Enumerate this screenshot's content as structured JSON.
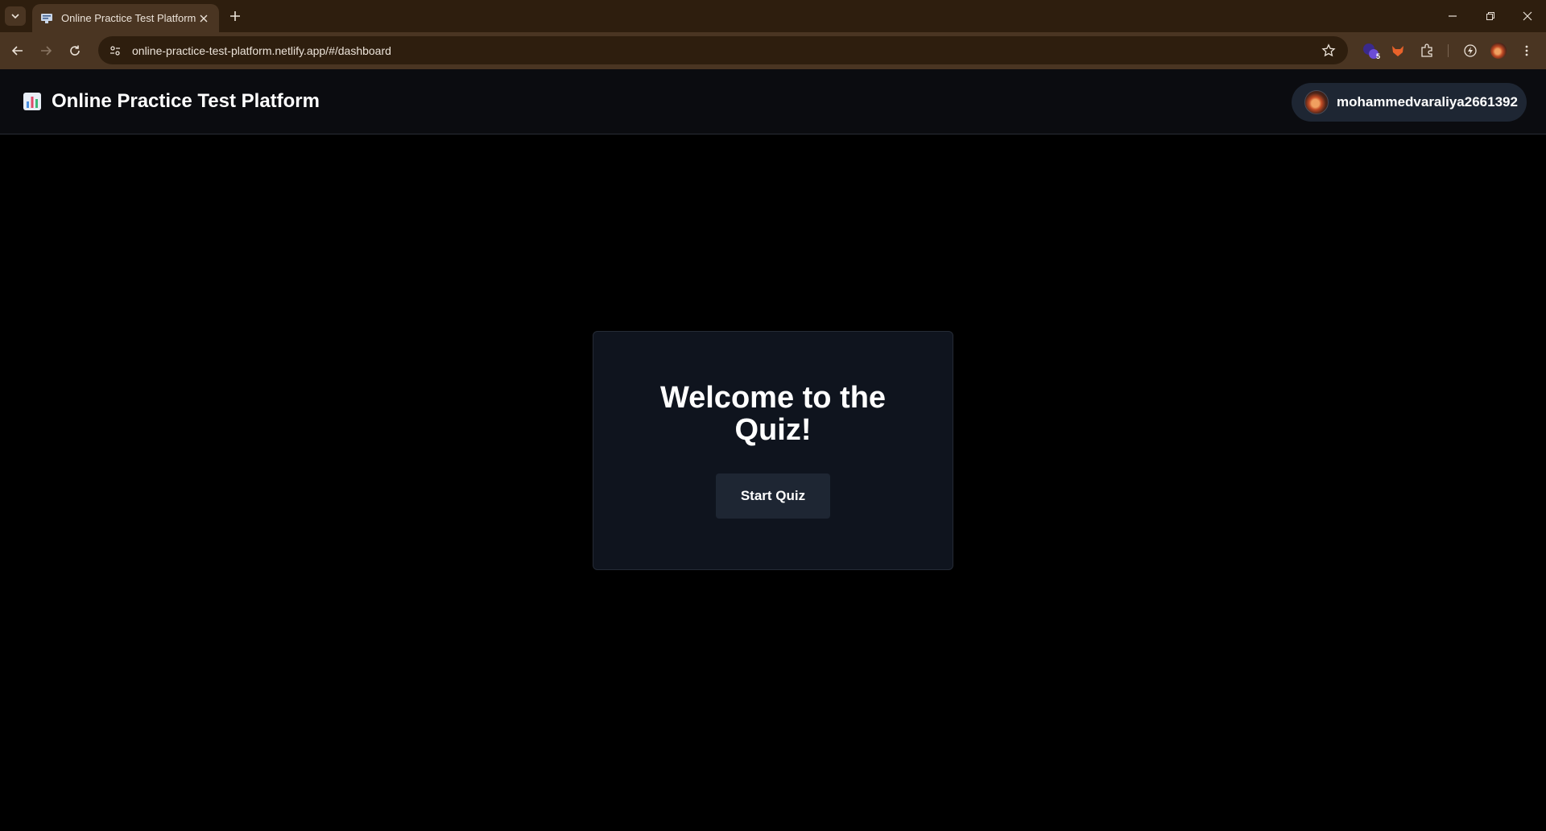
{
  "browser": {
    "tab_title": "Online Practice Test Platform",
    "url": "online-practice-test-platform.netlify.app/#/dashboard",
    "extension_badge": "5",
    "accent": "#4a3522"
  },
  "header": {
    "brand_icon": "bar-chart-icon",
    "title": "Online Practice Test Platform",
    "username": "mohammedvaraliya2661392"
  },
  "card": {
    "title": "Welcome to the Quiz!",
    "start_button_label": "Start Quiz"
  }
}
